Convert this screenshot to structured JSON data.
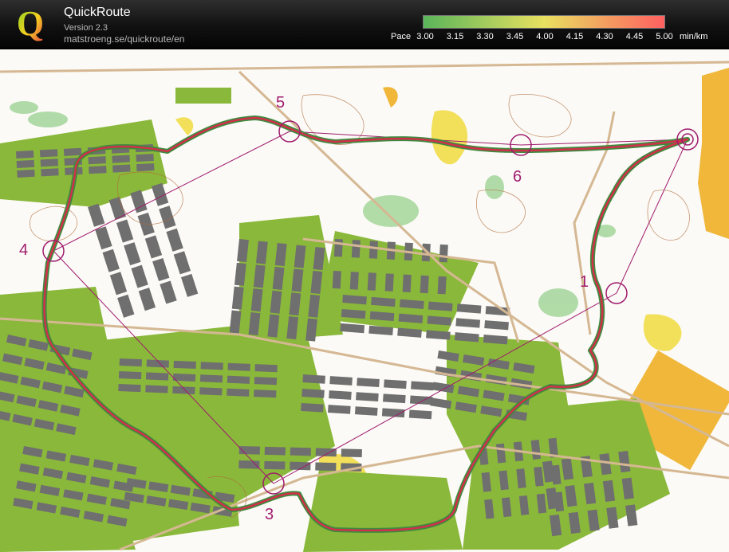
{
  "app": {
    "title": "QuickRoute",
    "version": "Version 2.3",
    "url": "matstroeng.se/quickroute/en"
  },
  "pace_legend": {
    "label": "Pace",
    "ticks": [
      "3.00",
      "3.15",
      "3.30",
      "3.45",
      "4.00",
      "4.15",
      "4.30",
      "4.45",
      "5.00"
    ],
    "unit": "min/km",
    "colors": [
      "#5ab55a",
      "#e8e060",
      "#ff6060"
    ]
  },
  "controls": [
    "1",
    "3",
    "4",
    "5",
    "6"
  ],
  "colors": {
    "map_white": "#fbfaf6",
    "vegetation_green": "#8ab83a",
    "open_yellow": "#f0b73a",
    "building": "#6f6f6f",
    "control_purple": "#a01c6e",
    "route_red": "#d0304a",
    "route_green": "#3f8a3f"
  }
}
